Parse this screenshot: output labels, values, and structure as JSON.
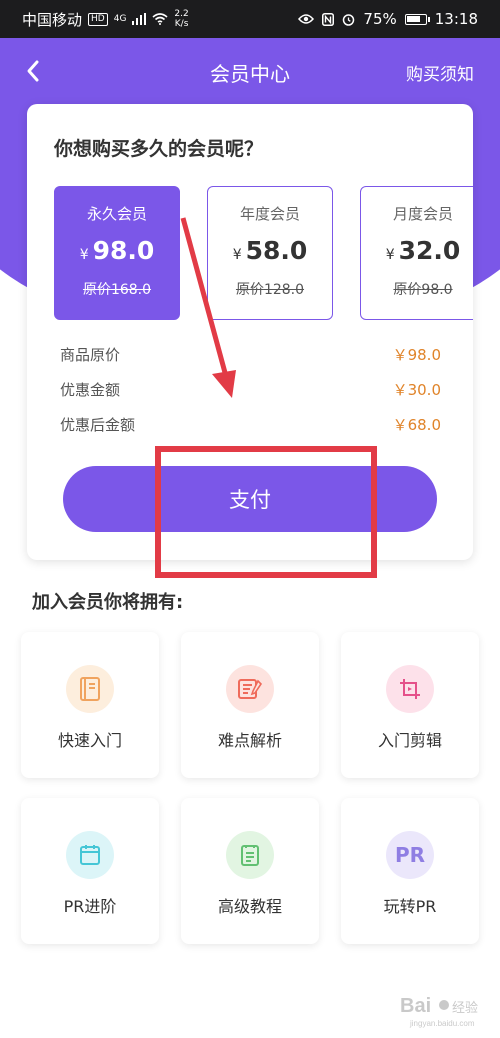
{
  "status_bar": {
    "carrier": "中国移动",
    "hd": "HD",
    "network": "4G",
    "speed_value": "2.2",
    "speed_unit": "K/s",
    "battery": "75%",
    "battery_level": 0.75,
    "time": "13:18"
  },
  "nav": {
    "title": "会员中心",
    "right_link": "购买须知"
  },
  "purchase_card": {
    "question": "你想购买多久的会员呢？",
    "plans": [
      {
        "name": "永久会员",
        "currency": "¥",
        "price": "98.0",
        "original_label": "原价",
        "original_price": "168.0",
        "selected": true
      },
      {
        "name": "年度会员",
        "currency": "¥",
        "price": "58.0",
        "original_label": "原价",
        "original_price": "128.0",
        "selected": false
      },
      {
        "name": "月度会员",
        "currency": "¥",
        "price": "32.0",
        "original_label": "原价",
        "original_price": "98.0",
        "selected": false
      }
    ],
    "summary": [
      {
        "label": "商品原价",
        "value": "￥98.0"
      },
      {
        "label": "优惠金额",
        "value": "￥30.0"
      },
      {
        "label": "优惠后金额",
        "value": "￥68.0"
      }
    ],
    "pay_label": "支付"
  },
  "benefits": {
    "title": "加入会员你将拥有:",
    "items": [
      {
        "label": "快速入门",
        "icon": "notebook-icon",
        "color": "#f0a35e",
        "bg": "#fdeedd"
      },
      {
        "label": "难点解析",
        "icon": "document-edit-icon",
        "color": "#ef6b5b",
        "bg": "#fde3df"
      },
      {
        "label": "入门剪辑",
        "icon": "crop-icon",
        "color": "#e5508a",
        "bg": "#fde1ea"
      },
      {
        "label": "PR进阶",
        "icon": "calendar-icon",
        "color": "#45c6d6",
        "bg": "#dcf5f8"
      },
      {
        "label": "高级教程",
        "icon": "list-document-icon",
        "color": "#62c072",
        "bg": "#e2f5e2"
      },
      {
        "label": "玩转PR",
        "icon": "pr-logo-icon",
        "icon_text": "PR",
        "color": "#8f7ee3",
        "bg": "#ebe7fb"
      }
    ]
  },
  "watermark": {
    "brand": "Bai",
    "sub": "经验",
    "url": "jingyan.baidu.com"
  },
  "colors": {
    "primary": "#7b57e8",
    "price_accent": "#e0842a",
    "annotation_red": "#e23b46"
  }
}
